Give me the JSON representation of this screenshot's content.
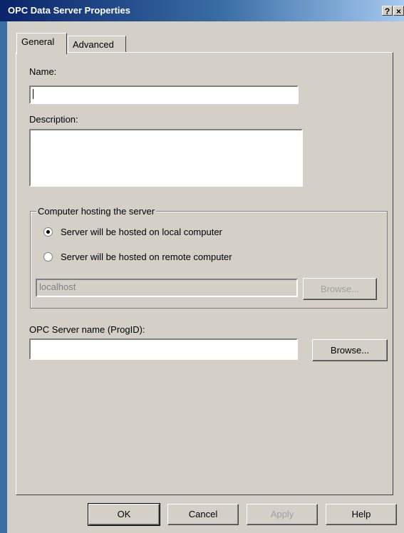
{
  "window": {
    "title": "OPC Data Server Properties",
    "help_glyph": "?",
    "close_glyph": "×"
  },
  "tabs": [
    {
      "label": "General",
      "selected": true
    },
    {
      "label": "Advanced",
      "selected": false
    }
  ],
  "general": {
    "name_label": "Name:",
    "name_value": "",
    "description_label": "Description:",
    "description_value": "",
    "group": {
      "title": "Computer hosting the server",
      "local_option": "Server will be hosted on local computer",
      "remote_option": "Server will be hosted on remote computer",
      "selected": "local",
      "host_value": "localhost",
      "browse_label": "Browse..."
    },
    "progid_label": "OPC Server name (ProgID):",
    "progid_value": "",
    "progid_browse_label": "Browse..."
  },
  "footer": {
    "ok": "OK",
    "cancel": "Cancel",
    "apply": "Apply",
    "help": "Help"
  }
}
